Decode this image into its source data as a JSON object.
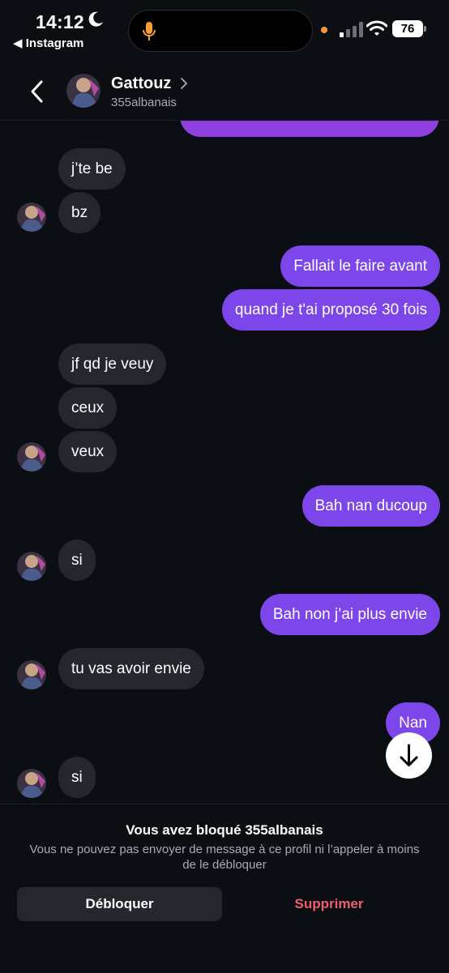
{
  "status_bar": {
    "time": "14:12",
    "back_app": "◀ Instagram",
    "battery": "76"
  },
  "header": {
    "contact_name": "Gattouz",
    "username": "355albanais"
  },
  "messages": [
    {
      "from": "me",
      "text": ""
    },
    {
      "from": "them",
      "text": "j’te be"
    },
    {
      "from": "them",
      "text": "bz"
    },
    {
      "from": "me",
      "text": "Fallait le faire avant"
    },
    {
      "from": "me",
      "text": "quand je t'ai proposé 30 fois"
    },
    {
      "from": "them",
      "text": "jf qd je veuy"
    },
    {
      "from": "them",
      "text": "ceux"
    },
    {
      "from": "them",
      "text": "veux"
    },
    {
      "from": "me",
      "text": "Bah nan ducoup"
    },
    {
      "from": "them",
      "text": "si"
    },
    {
      "from": "me",
      "text": "Bah non j’ai plus envie"
    },
    {
      "from": "them",
      "text": "tu vas avoir envie"
    },
    {
      "from": "me",
      "text": "Nan"
    },
    {
      "from": "them",
      "text": "si"
    }
  ],
  "blocked": {
    "title": "Vous avez bloqué 355albanais",
    "description": "Vous ne pouvez pas envoyer de message à ce profil ni l’appeler à moins de le débloquer",
    "unblock_label": "Débloquer",
    "delete_label": "Supprimer"
  },
  "colors": {
    "background": "#0b0e13",
    "incoming_bubble": "#25272e",
    "outgoing_bubble": "#7d46ea",
    "delete_text": "#ef5f6a"
  },
  "icons": [
    "moon-icon",
    "microphone-icon",
    "signal-icon",
    "wifi-icon",
    "back-chevron-icon",
    "profile-chevron-icon",
    "arrow-down-icon"
  ]
}
